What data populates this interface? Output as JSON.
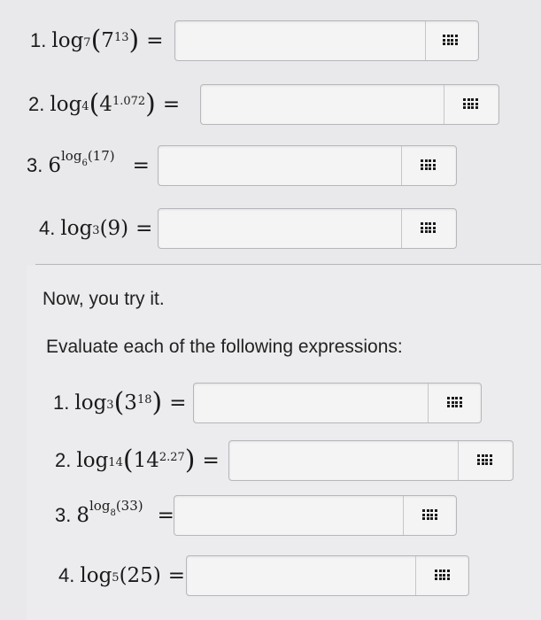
{
  "top_problems": [
    {
      "number": "1.",
      "fn": "log",
      "base": "7",
      "arg_base": "7",
      "arg_exp": "13",
      "eq": "="
    },
    {
      "number": "2.",
      "fn": "log",
      "base": "4",
      "arg_base": "4",
      "arg_exp": "1.072",
      "eq": "="
    },
    {
      "number": "3.",
      "lead": "6",
      "exp_fn": "log",
      "exp_base": "6",
      "exp_arg": "(17)",
      "eq": "="
    },
    {
      "number": "4.",
      "fn": "log",
      "base": "3",
      "arg": "(9)",
      "eq": "="
    }
  ],
  "section": {
    "intro": "Now, you try it.",
    "instructions": "Evaluate each of the following expressions:"
  },
  "bottom_problems": [
    {
      "number": "1.",
      "fn": "log",
      "base": "3",
      "arg_base": "3",
      "arg_exp": "18",
      "eq": "="
    },
    {
      "number": "2.",
      "fn": "log",
      "base": "14",
      "arg_base": "14",
      "arg_exp": "2.27",
      "eq": "="
    },
    {
      "number": "3.",
      "lead": "8",
      "exp_fn": "log",
      "exp_base": "8",
      "exp_arg": "(33)",
      "eq": "="
    },
    {
      "number": "4.",
      "fn": "log",
      "base": "5",
      "arg": "(25)",
      "eq": "="
    }
  ],
  "icons": {
    "keypad": "keypad-grid-icon"
  }
}
